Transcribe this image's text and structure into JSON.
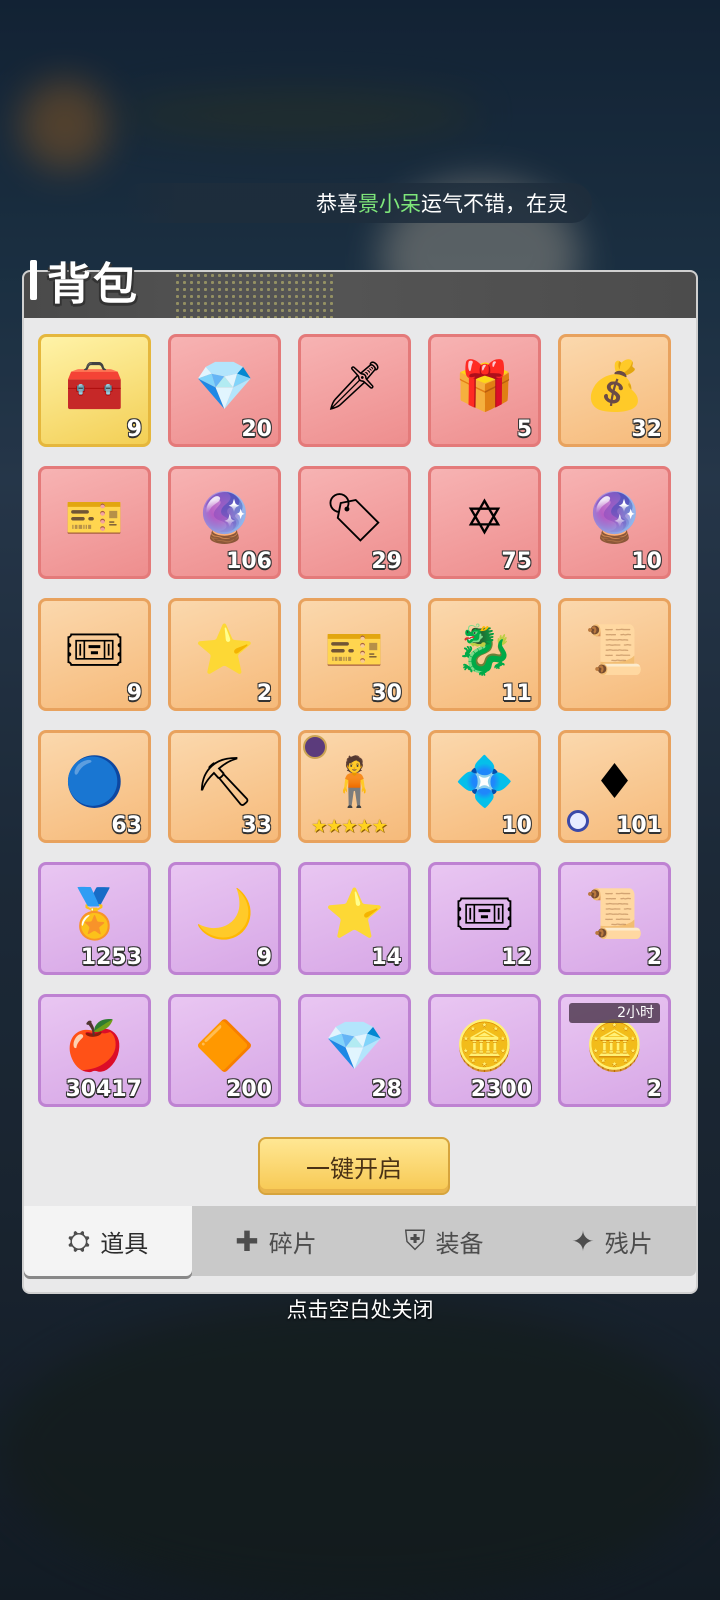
{
  "broadcast": {
    "prefix": "恭喜",
    "name": "景小呆",
    "suffix": "运气不错，在灵"
  },
  "title": "背包",
  "items": [
    {
      "rarity": "gold",
      "icon": "blue-gold-chest-icon",
      "glyph": "🧰",
      "count": "9"
    },
    {
      "rarity": "red",
      "icon": "red-gem-chest-icon",
      "glyph": "💎",
      "count": "20"
    },
    {
      "rarity": "red",
      "icon": "sword-card-icon",
      "glyph": "🗡",
      "count": ""
    },
    {
      "rarity": "red",
      "icon": "red-treasure-chest-icon",
      "glyph": "🎁",
      "count": "5"
    },
    {
      "rarity": "orange",
      "icon": "gold-gem-chest-icon",
      "glyph": "💰",
      "count": "32"
    },
    {
      "rarity": "red",
      "icon": "gold-voucher-icon",
      "glyph": "🎫",
      "count": ""
    },
    {
      "rarity": "red",
      "icon": "purple-crystal-icon",
      "glyph": "🔮",
      "count": "106"
    },
    {
      "rarity": "red",
      "icon": "green-talisman-icon",
      "glyph": "🏷",
      "count": "29"
    },
    {
      "rarity": "red",
      "icon": "star-orb-icon",
      "glyph": "✡",
      "count": "75"
    },
    {
      "rarity": "red",
      "icon": "purple-orb-icon",
      "glyph": "🔮",
      "count": "10"
    },
    {
      "rarity": "orange",
      "icon": "red-ticket-icon",
      "glyph": "🎟",
      "count": "9"
    },
    {
      "rarity": "orange",
      "icon": "gold-star-icon",
      "glyph": "⭐",
      "count": "2"
    },
    {
      "rarity": "orange",
      "icon": "exchange-ticket-icon",
      "glyph": "🎫",
      "count": "30"
    },
    {
      "rarity": "orange",
      "icon": "dragon-coin-icon",
      "glyph": "🐉",
      "count": "11"
    },
    {
      "rarity": "orange",
      "icon": "star-scroll-icon",
      "glyph": "📜",
      "count": ""
    },
    {
      "rarity": "orange",
      "icon": "blue-orb-stand-icon",
      "glyph": "🔵",
      "count": "63"
    },
    {
      "rarity": "orange",
      "icon": "pickaxe-icon",
      "glyph": "⛏",
      "count": "33"
    },
    {
      "rarity": "orange",
      "icon": "character-figure-icon",
      "glyph": "🧍",
      "count": "",
      "stars": "★★★★★"
    },
    {
      "rarity": "orange",
      "icon": "blue-crystal-icon",
      "glyph": "💠",
      "count": "10"
    },
    {
      "rarity": "orange",
      "icon": "red-gem-timed-icon",
      "glyph": "♦",
      "count": "101"
    },
    {
      "rarity": "purple",
      "icon": "blue-medal-icon",
      "glyph": "🏅",
      "count": "1253"
    },
    {
      "rarity": "purple",
      "icon": "moon-ticket-icon",
      "glyph": "🌙",
      "count": "9"
    },
    {
      "rarity": "purple",
      "icon": "silver-star-icon",
      "glyph": "⭐",
      "count": "14"
    },
    {
      "rarity": "purple",
      "icon": "ticket-icon",
      "glyph": "🎟",
      "count": "12"
    },
    {
      "rarity": "purple",
      "icon": "refresh-scroll-icon",
      "glyph": "📜",
      "count": "2"
    },
    {
      "rarity": "purple",
      "icon": "apple-icon",
      "glyph": "🍎",
      "count": "30417"
    },
    {
      "rarity": "purple",
      "icon": "orange-gem-icon",
      "glyph": "🔶",
      "count": "200"
    },
    {
      "rarity": "purple",
      "icon": "purple-crystal-cluster-icon",
      "glyph": "💎",
      "count": "28"
    },
    {
      "rarity": "purple",
      "icon": "jade-coin-icon",
      "glyph": "🪙",
      "count": "2300"
    },
    {
      "rarity": "purple",
      "icon": "gold-coins-icon",
      "glyph": "🪙",
      "count": "2",
      "badge": "2小时"
    }
  ],
  "open_button": "一键开启",
  "tabs": [
    {
      "label": "道具",
      "icon": "props-icon",
      "glyph": "⛭"
    },
    {
      "label": "碎片",
      "icon": "puzzle-piece-icon",
      "glyph": "✚"
    },
    {
      "label": "装备",
      "icon": "shield-icon",
      "glyph": "⛨"
    },
    {
      "label": "残片",
      "icon": "compass-star-icon",
      "glyph": "✦"
    }
  ],
  "close_hint": "点击空白处关闭",
  "colors": {
    "gold": "#f3cf55",
    "red": "#ee8e8e",
    "orange": "#f6ba7a",
    "purple": "#d7a7e6",
    "button": "#f7c852"
  }
}
